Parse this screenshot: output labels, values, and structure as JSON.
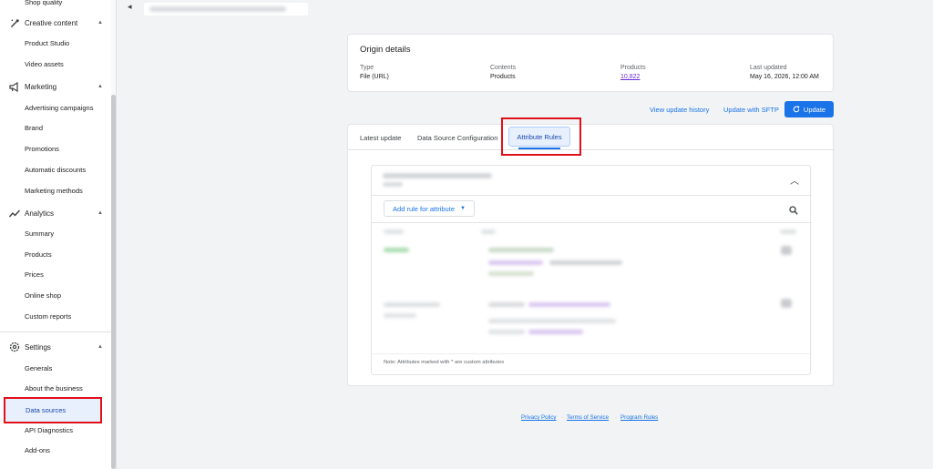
{
  "sidebar": {
    "top_item": "Shop quality",
    "sections": [
      {
        "label": "Creative content",
        "icon": "brush-icon",
        "items": [
          "Product Studio",
          "Video assets"
        ]
      },
      {
        "label": "Marketing",
        "icon": "megaphone-icon",
        "items": [
          "Advertising campaigns",
          "Brand",
          "Promotions",
          "Automatic discounts",
          "Marketing methods"
        ]
      },
      {
        "label": "Analytics",
        "icon": "trending-icon",
        "items": [
          "Summary",
          "Products",
          "Prices",
          "Online shop",
          "Custom reports"
        ]
      },
      {
        "label": "Settings",
        "icon": "gear-icon",
        "items": [
          "Generals",
          "About the business",
          "Data sources",
          "API Diagnostics",
          "Add-ons"
        ]
      }
    ],
    "selected_item": "Data sources"
  },
  "origin": {
    "title": "Origin details",
    "type_label": "Type",
    "type_value": "File (URL)",
    "contents_label": "Contents",
    "contents_value": "Products",
    "products_label": "Products",
    "products_value": "10,822",
    "updated_label": "Last updated",
    "updated_value": "May 16, 2026, 12:00 AM"
  },
  "actions": {
    "history": "View update history",
    "sftp": "Update with SFTP",
    "update": "Update"
  },
  "tabs": {
    "latest": "Latest update",
    "config": "Data Source Configuration",
    "rules": "Attribute Rules"
  },
  "rules": {
    "add_rule": "Add rule for attribute",
    "note": "Note: Attributes marked with * are custom attributes"
  },
  "footer": {
    "privacy": "Privacy Policy",
    "terms": "Terms of Service",
    "program": "Program Rules"
  },
  "colors": {
    "accent": "#1a73e8",
    "highlight": "#e0101a"
  }
}
